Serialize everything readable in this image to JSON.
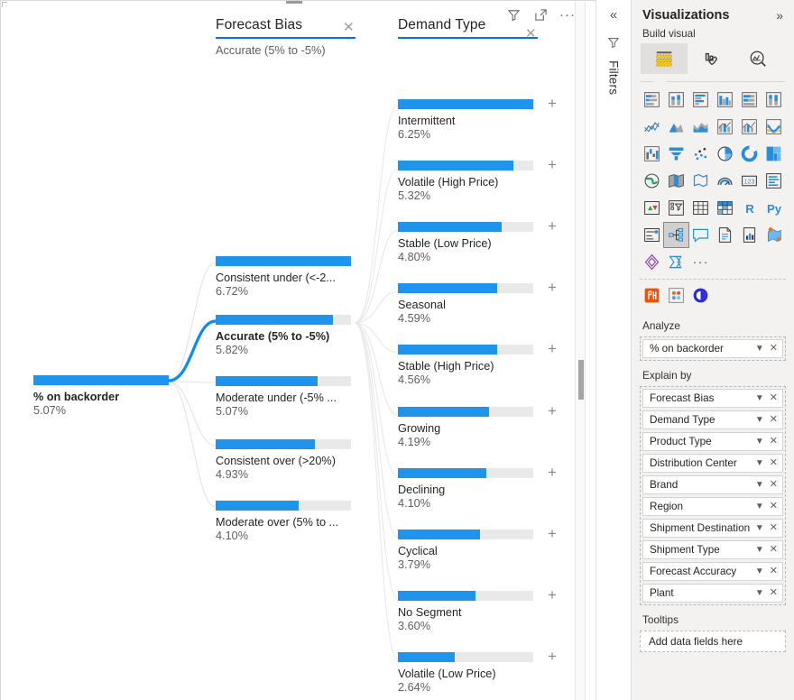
{
  "canvas": {
    "root": {
      "label": "% on backorder",
      "value": "5.07%",
      "fill_ratio": 1.0
    },
    "columns": [
      {
        "title": "Forecast Bias",
        "subtitle": "Accurate (5% to -5%)",
        "close_icon": "close-icon",
        "nodes": [
          {
            "label": "Consistent under (<-2...",
            "value": "6.72%",
            "fill_ratio": 1.0,
            "selected": false
          },
          {
            "label": "Accurate (5% to -5%)",
            "value": "5.82%",
            "fill_ratio": 0.866,
            "selected": true
          },
          {
            "label": "Moderate under (-5% ...",
            "value": "5.07%",
            "fill_ratio": 0.754,
            "selected": false
          },
          {
            "label": "Consistent over (>20%)",
            "value": "4.93%",
            "fill_ratio": 0.733,
            "selected": false
          },
          {
            "label": "Moderate over (5% to ...",
            "value": "4.10%",
            "fill_ratio": 0.61,
            "selected": false
          }
        ]
      },
      {
        "title": "Demand Type",
        "subtitle": "",
        "close_icon": "close-icon",
        "nodes": [
          {
            "label": "Intermittent",
            "value": "6.25%",
            "fill_ratio": 1.0,
            "expand_icon": "plus-icon"
          },
          {
            "label": "Volatile (High Price)",
            "value": "5.32%",
            "fill_ratio": 0.851,
            "expand_icon": "plus-icon"
          },
          {
            "label": "Stable (Low Price)",
            "value": "4.80%",
            "fill_ratio": 0.768,
            "expand_icon": "plus-icon"
          },
          {
            "label": "Seasonal",
            "value": "4.59%",
            "fill_ratio": 0.734,
            "expand_icon": "plus-icon"
          },
          {
            "label": "Stable (High Price)",
            "value": "4.56%",
            "fill_ratio": 0.73,
            "expand_icon": "plus-icon"
          },
          {
            "label": "Growing",
            "value": "4.19%",
            "fill_ratio": 0.67,
            "expand_icon": "plus-icon"
          },
          {
            "label": "Declining",
            "value": "4.10%",
            "fill_ratio": 0.656,
            "expand_icon": "plus-icon"
          },
          {
            "label": "Cyclical",
            "value": "3.79%",
            "fill_ratio": 0.606,
            "expand_icon": "plus-icon"
          },
          {
            "label": "No Segment",
            "value": "3.60%",
            "fill_ratio": 0.576,
            "expand_icon": "plus-icon"
          },
          {
            "label": "Volatile (Low Price)",
            "value": "2.64%",
            "fill_ratio": 0.422,
            "expand_icon": "plus-icon"
          }
        ]
      }
    ],
    "visual_tools": [
      {
        "name": "filter-icon"
      },
      {
        "name": "focus-mode-icon"
      },
      {
        "name": "more-options-icon",
        "glyph": "···"
      }
    ]
  },
  "rail": {
    "collapse_icon": "chevron-double-left-icon",
    "filter_icon": "filter-icon",
    "label": "Filters"
  },
  "viz_pane": {
    "title": "Visualizations",
    "expand_icon": "chevron-double-right-icon",
    "subtitle": "Build visual",
    "build_tabs": [
      {
        "name": "fields-tab",
        "selected": true
      },
      {
        "name": "format-tab",
        "selected": false
      },
      {
        "name": "analytics-tab",
        "selected": false
      }
    ],
    "visual_icons": [
      "stacked-bar-chart-icon",
      "stacked-column-chart-icon",
      "clustered-bar-chart-icon",
      "clustered-column-chart-icon",
      "100-stacked-bar-chart-icon",
      "100-stacked-column-chart-icon",
      "line-chart-icon",
      "area-chart-icon",
      "stacked-area-chart-icon",
      "line-stacked-column-chart-icon",
      "line-clustered-column-chart-icon",
      "ribbon-chart-icon",
      "waterfall-chart-icon",
      "funnel-chart-icon",
      "scatter-chart-icon",
      "pie-chart-icon",
      "donut-chart-icon",
      "treemap-icon",
      "map-icon",
      "filled-map-icon",
      "shape-map-icon",
      "gauge-icon",
      "card-icon",
      "multi-row-card-icon",
      "kpi-icon",
      "slicer-icon",
      "table-icon",
      "matrix-icon",
      "r-script-visual-icon",
      "python-visual-icon",
      "key-influencers-icon",
      "decomposition-tree-icon",
      "qa-visual-icon",
      "smart-narrative-icon",
      "paginated-report-icon",
      "arcgis-maps-icon",
      "power-apps-icon",
      "power-automate-icon",
      "more-visuals-icon"
    ],
    "selected_visual_icon": "decomposition-tree-icon",
    "custom_visual_icons": [
      "html-content-icon",
      "drill-down-donut-icon",
      "infographic-designer-icon"
    ],
    "analyze": {
      "section_label": "Analyze",
      "fields": [
        {
          "name": "% on backorder",
          "chevron_icon": "chevron-down-icon",
          "remove_icon": "close-icon"
        }
      ]
    },
    "explain_by": {
      "section_label": "Explain by",
      "fields": [
        {
          "name": "Forecast Bias",
          "chevron_icon": "chevron-down-icon",
          "remove_icon": "close-icon"
        },
        {
          "name": "Demand Type",
          "chevron_icon": "chevron-down-icon",
          "remove_icon": "close-icon"
        },
        {
          "name": "Product Type",
          "chevron_icon": "chevron-down-icon",
          "remove_icon": "close-icon"
        },
        {
          "name": "Distribution Center",
          "chevron_icon": "chevron-down-icon",
          "remove_icon": "close-icon"
        },
        {
          "name": "Brand",
          "chevron_icon": "chevron-down-icon",
          "remove_icon": "close-icon"
        },
        {
          "name": "Region",
          "chevron_icon": "chevron-down-icon",
          "remove_icon": "close-icon"
        },
        {
          "name": "Shipment Destination",
          "chevron_icon": "chevron-down-icon",
          "remove_icon": "close-icon"
        },
        {
          "name": "Shipment Type",
          "chevron_icon": "chevron-down-icon",
          "remove_icon": "close-icon"
        },
        {
          "name": "Forecast Accuracy",
          "chevron_icon": "chevron-down-icon",
          "remove_icon": "close-icon"
        },
        {
          "name": "Plant",
          "chevron_icon": "chevron-down-icon",
          "remove_icon": "close-icon"
        }
      ]
    },
    "tooltips": {
      "section_label": "Tooltips",
      "placeholder": "Add data fields here"
    }
  },
  "colors": {
    "bar_fill": "#1f94ec",
    "bar_track": "#e9e9e9",
    "accent_underline": "#0078d4",
    "selected_link": "#0f8bef",
    "link": "#e3e3e3",
    "pane_bg": "#f3f2f1"
  }
}
